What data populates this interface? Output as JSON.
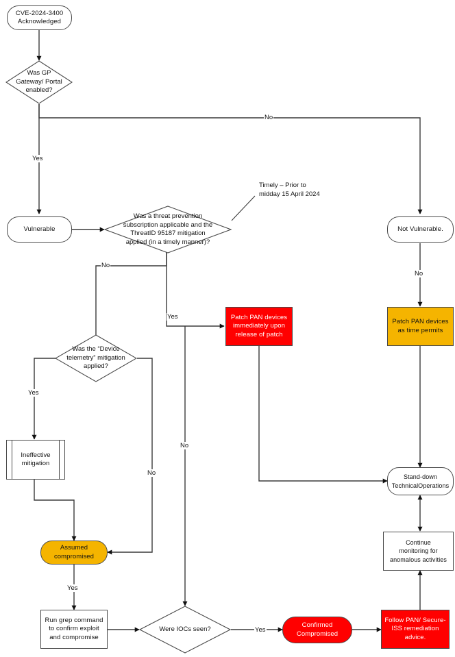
{
  "diagram": {
    "title": "CVE-2024-3400 response decision flowchart",
    "colors": {
      "red": "#ff0000",
      "amber": "#f5b400",
      "white": "#ffffff",
      "stroke": "#4a4a4a",
      "text": "#111111",
      "red_text": "#ffffff"
    },
    "nodes": {
      "start": "CVE-2024-3400\nAcknowledged",
      "gp_gateway_decision": "Was GP\nGateway/ Portal\nenabled?",
      "vulnerable": "Vulnerable",
      "not_vulnerable": "Not Vulnerable.",
      "threat_prevention_decision": "Was a threat prevention\nsubscription applicable and the\nThreatID 95187 mitigation\napplied (in a timely manner)?",
      "timely_annotation": "Timely – Prior to\nmidday 15 April 2024",
      "patch_immediately": "Patch PAN devices\nimmediately upon\nrelease of patch",
      "patch_as_time_permits": "Patch PAN devices\nas time permits",
      "device_telemetry_decision": "Was the “Device\ntelemetry” mitigation\napplied?",
      "ineffective_mitigation": "Ineffective\nmitigation",
      "assumed_compromised": "Assumed\ncompromised",
      "run_grep": "Run grep command\nto confirm exploit\nand compromise",
      "iocs_decision": "Were IOCs seen?",
      "confirmed_compromised": "Confirmed\nCompromised",
      "follow_remediation": "Follow PAN/ Secure-\nISS remediation\nadvice.",
      "stand_down": "Stand-down\nTechnicalOperations",
      "continue_monitoring": "Continue\nmonitoring for\nanomalous activities"
    },
    "edge_labels": {
      "gp_no": "No",
      "gp_yes": "Yes",
      "threat_no": "No",
      "threat_yes": "Yes",
      "not_vuln_no": "No",
      "telemetry_yes": "Yes",
      "telemetry_no": "No",
      "mid_no": "No",
      "assumed_yes": "Yes",
      "iocs_yes": "Yes"
    }
  }
}
